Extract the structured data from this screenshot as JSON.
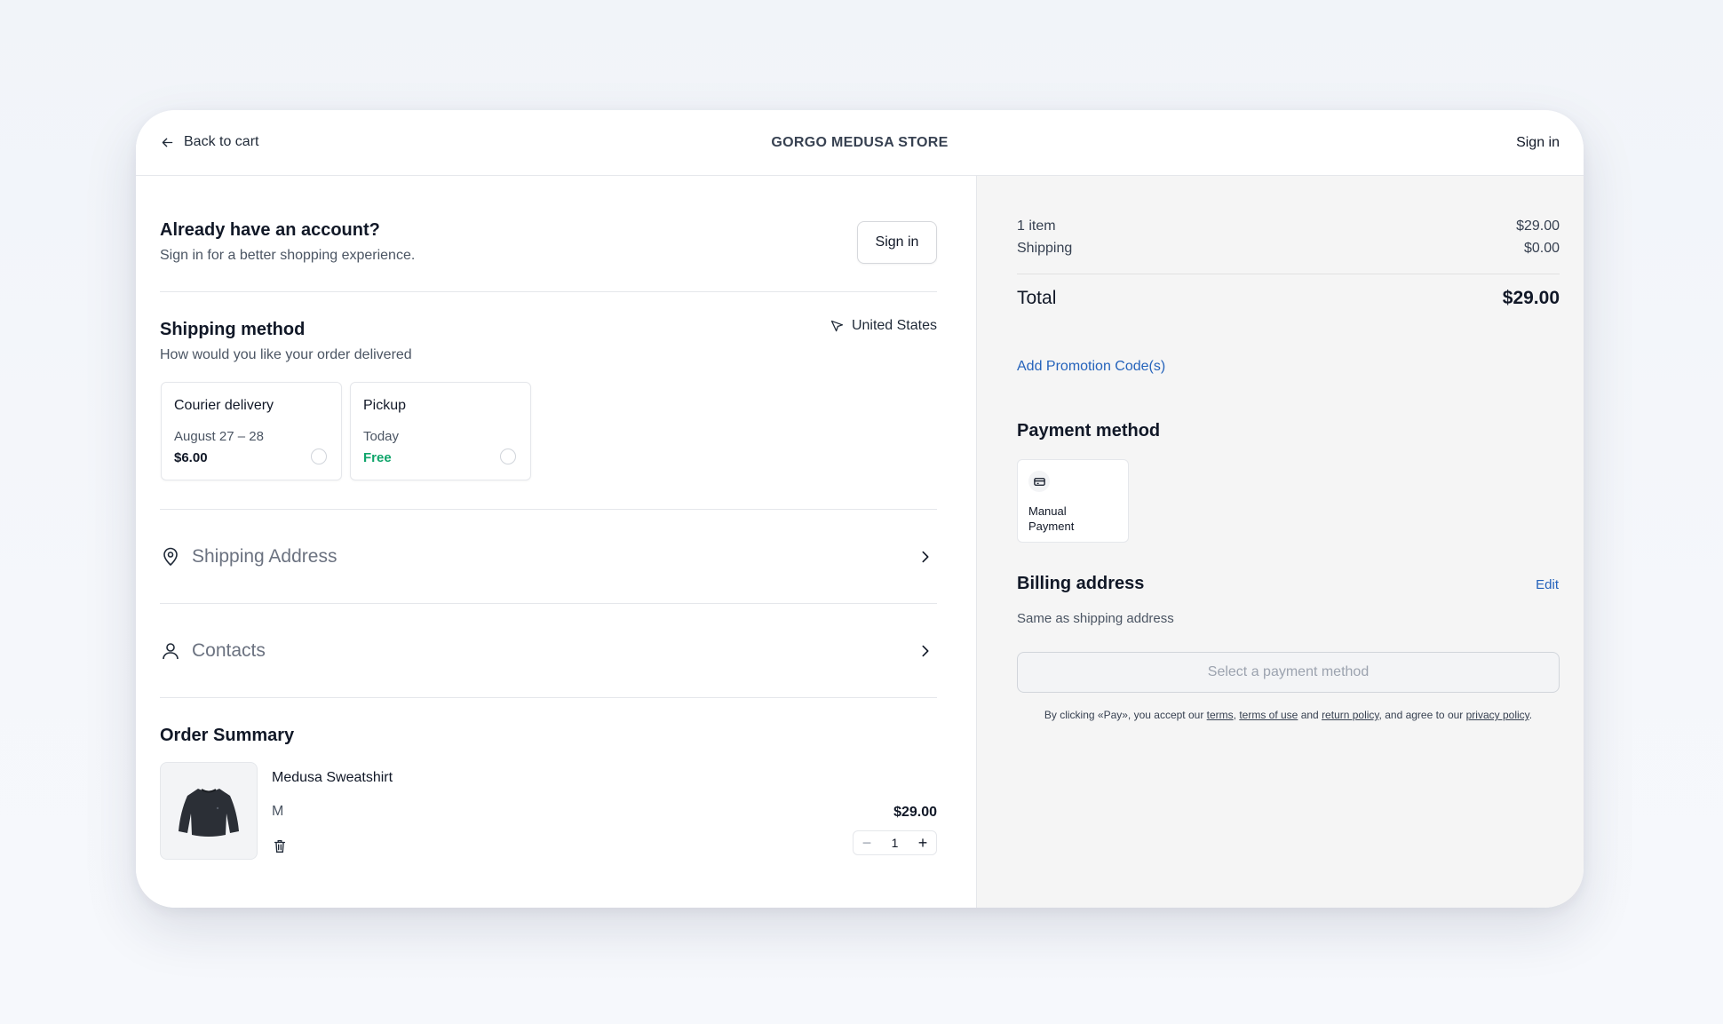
{
  "header": {
    "back_label": "Back to cart",
    "store_name": "GORGO MEDUSA STORE",
    "sign_in_label": "Sign in"
  },
  "account": {
    "title": "Already have an account?",
    "subtitle": "Sign in for a better shopping experience.",
    "button_label": "Sign in"
  },
  "shipping": {
    "title": "Shipping method",
    "subtitle": "How would you like your order delivered",
    "country": "United States",
    "options": [
      {
        "name": "Courier delivery",
        "date": "August 27 – 28",
        "price": "$6.00"
      },
      {
        "name": "Pickup",
        "date": "Today",
        "price": "Free"
      }
    ]
  },
  "sections": {
    "shipping_address": "Shipping Address",
    "contacts": "Contacts"
  },
  "order_summary": {
    "title": "Order Summary",
    "item": {
      "name": "Medusa Sweatshirt",
      "variant": "M",
      "price": "$29.00",
      "quantity": "1"
    }
  },
  "summary": {
    "items_label": "1 item",
    "items_value": "$29.00",
    "shipping_label": "Shipping",
    "shipping_value": "$0.00",
    "total_label": "Total",
    "total_value": "$29.00",
    "promo_label": "Add Promotion Code(s)"
  },
  "payment": {
    "title": "Payment method",
    "method_label": "Manual Payment"
  },
  "billing": {
    "title": "Billing address",
    "edit_label": "Edit",
    "subtitle": "Same as shipping address"
  },
  "pay_button_label": "Select a payment method",
  "legal": {
    "prefix": "By clicking «Pay», you accept our ",
    "terms": "terms",
    "sep1": ", ",
    "terms_of_use": "terms of use",
    "and": " and ",
    "return_policy": "return policy",
    "agree": ", and agree to our ",
    "privacy_policy": "privacy policy",
    "suffix": "."
  },
  "colors": {
    "accent_link": "#2563bb",
    "free_green": "#10a56b",
    "summary_panel": "#f5f5f5"
  }
}
